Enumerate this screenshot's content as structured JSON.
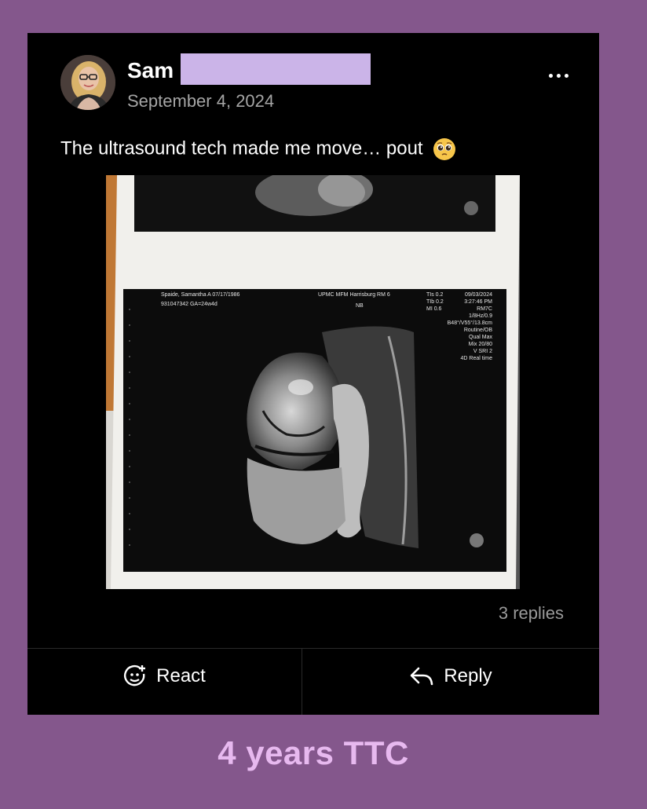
{
  "post": {
    "author": "Sam",
    "date": "September 4, 2024",
    "text": "The ultrasound tech made me move… pout",
    "emoji": "pleading-face",
    "replies": "3 replies"
  },
  "scan": {
    "patient": "Spaide, Samantha A 07/17/1986",
    "id_ga": "931047342  GA=24w4d",
    "facility": "UPMC MFM Harrisburg RM 6",
    "nb": "NB",
    "tis": "TIs  0.2",
    "tib": "TIb  0.2",
    "mi": "MI   0.6",
    "scan_date": "09/03/2024",
    "scan_time": "3:27:46 PM",
    "params": [
      "RM7C",
      "1/8Hz/0.9",
      "B48°/V55°/13.8cm",
      "Routine/OB",
      "Qual Max",
      "Mix 20/80",
      "V SRI 2",
      "4D Real time"
    ]
  },
  "actions": {
    "react_label": "React",
    "reply_label": "Reply"
  },
  "caption": "4 years TTC",
  "colors": {
    "background": "#84578c",
    "card": "#000000",
    "caption": "#e7b9ef",
    "redaction": "#cbb4e8"
  }
}
